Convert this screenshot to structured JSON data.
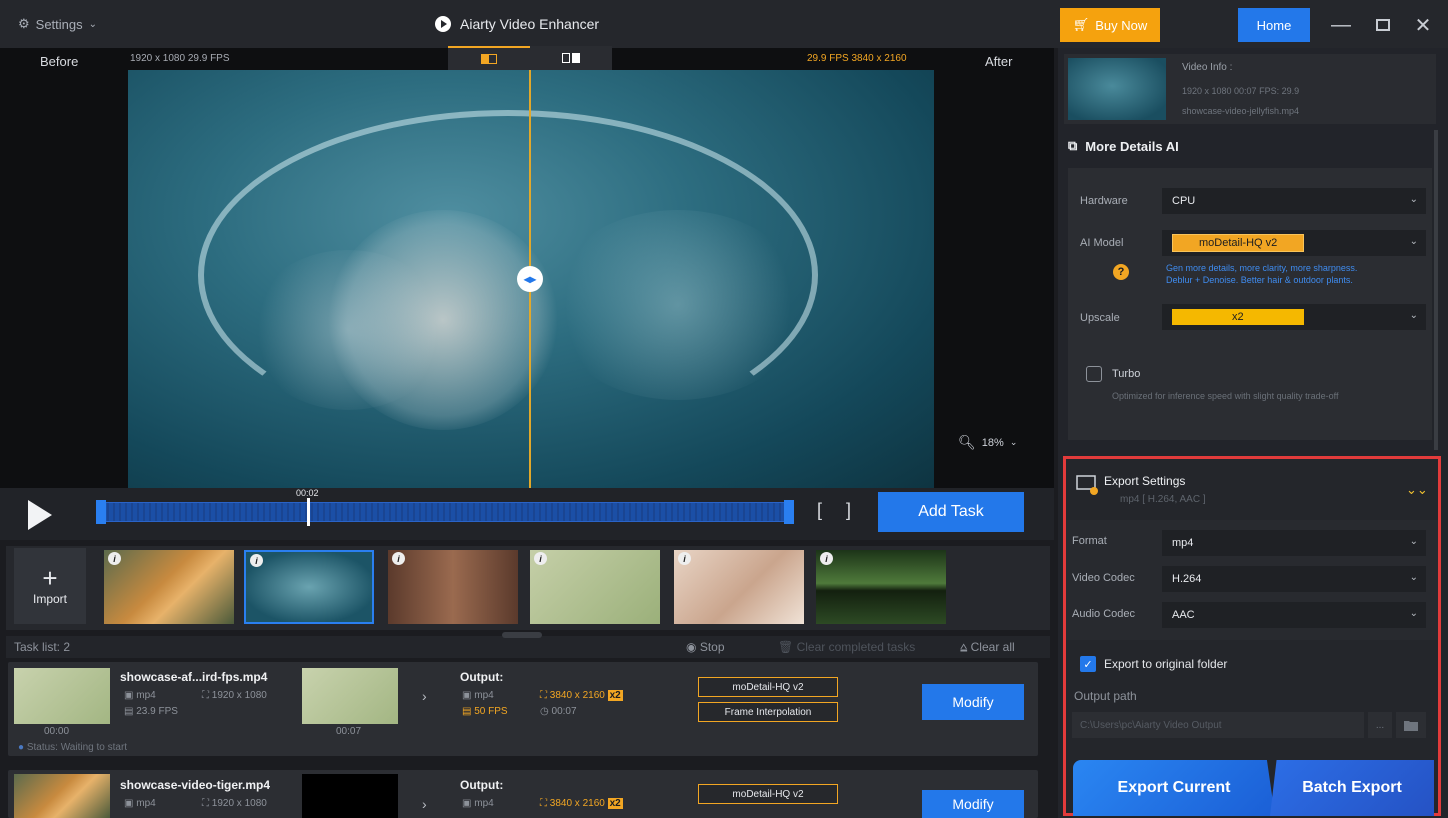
{
  "titlebar": {
    "settings_label": "Settings",
    "app_title": "Aiarty Video Enhancer",
    "buy_now": "Buy Now",
    "home": "Home"
  },
  "preview": {
    "before_label": "Before",
    "after_label": "After",
    "source_info": "1920 x 1080  29.9 FPS",
    "output_info": "29.9 FPS  3840 x 2160",
    "zoom": "18%"
  },
  "timeline": {
    "time": "00:02",
    "add_task": "Add Task"
  },
  "thumbnails": {
    "import_label": "Import",
    "badge": "i"
  },
  "tasklist": {
    "label": "Task list: 2",
    "stop": "Stop",
    "clear_completed": "Clear completed tasks",
    "clear_all": "Clear all",
    "output_label": "Output:",
    "modify": "Modify",
    "tasks": [
      {
        "filename": "showcase-af...ird-fps.mp4",
        "format": "mp4",
        "resolution": "1920 x 1080",
        "fps": "23.9 FPS",
        "time_start": "00:00",
        "time_end": "00:07",
        "out_format": "mp4",
        "out_resolution": "3840 x 2160",
        "out_scale": "x2",
        "out_fps": "50 FPS",
        "out_duration": "00:07",
        "model": "moDetail-HQ  v2",
        "extra": "Frame Interpolation",
        "status": "Status: Waiting to start"
      },
      {
        "filename": "showcase-video-tiger.mp4",
        "format": "mp4",
        "resolution": "1920 x 1080",
        "out_format": "mp4",
        "out_resolution": "3840 x 2160",
        "out_scale": "x2",
        "model": "moDetail-HQ  v2"
      }
    ]
  },
  "video_info": {
    "title": "Video Info :",
    "details": "1920 x 1080  00:07   FPS: 29.9",
    "file": "showcase-video-jellyfish.mp4"
  },
  "ai_panel": {
    "title": "More Details AI",
    "hardware_label": "Hardware",
    "hardware_value": "CPU",
    "model_label": "AI Model",
    "model_value": "moDetail-HQ  v2",
    "hint_line1": "Gen more details, more clarity, more sharpness.",
    "hint_line2": "Deblur + Denoise. Better hair & outdoor plants.",
    "upscale_label": "Upscale",
    "upscale_value": "x2",
    "turbo_label": "Turbo",
    "turbo_desc": "Optimized for inference speed with slight quality trade-off"
  },
  "export": {
    "title": "Export Settings",
    "subtitle": "mp4 [ H.264, AAC ]",
    "format_label": "Format",
    "format_value": "mp4",
    "vcodec_label": "Video Codec",
    "vcodec_value": "H.264",
    "acodec_label": "Audio Codec",
    "acodec_value": "AAC",
    "original_folder": "Export to original folder",
    "output_path_label": "Output path",
    "output_path_value": "C:\\Users\\pc\\Aiarty Video Output",
    "browse": "...",
    "export_current": "Export Current",
    "batch_export": "Batch Export"
  },
  "colors": {
    "accent": "#2378ea",
    "highlight": "#f2a623",
    "border_highlight": "#e23b3b"
  }
}
